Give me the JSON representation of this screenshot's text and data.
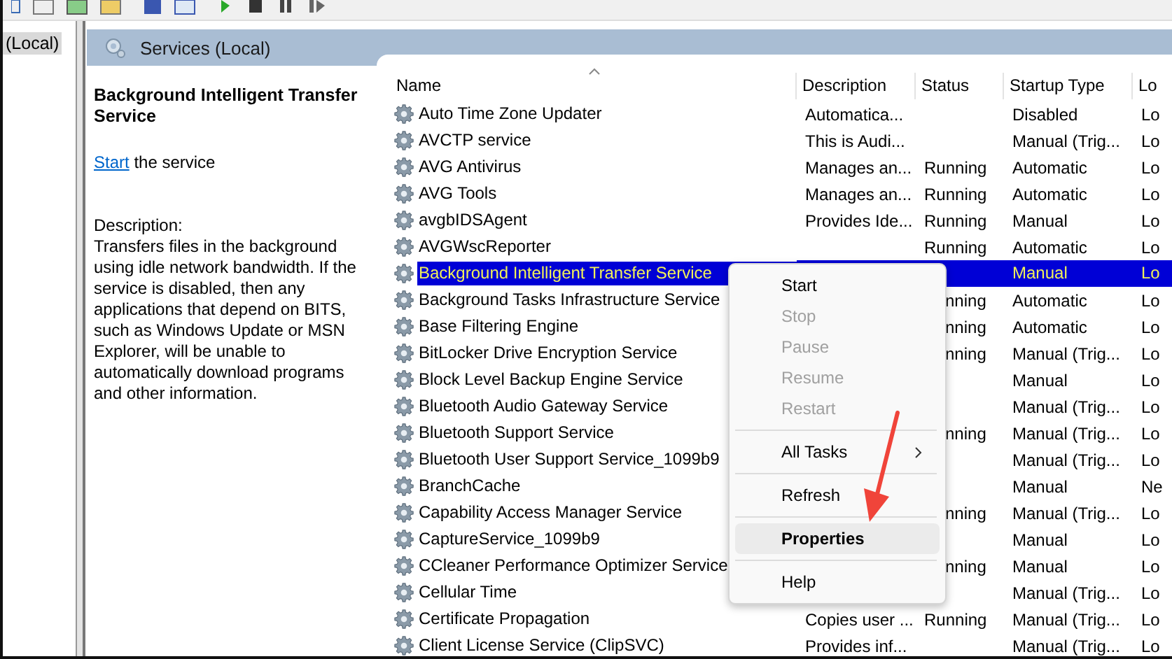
{
  "tree": {
    "items": [
      {
        "label": "(Local)",
        "selected": true
      }
    ]
  },
  "panel_header": {
    "title": "Services (Local)"
  },
  "details": {
    "title": "Background Intelligent Transfer Service",
    "action_link": "Start",
    "action_text": "the service",
    "description_label": "Description:",
    "description": "Transfers files in the background using idle network bandwidth. If the service is disabled, then any applications that depend on BITS, such as Windows Update or MSN Explorer, will be unable to automatically download programs and other information."
  },
  "table": {
    "columns": [
      "Name",
      "Description",
      "Status",
      "Startup Type",
      "Lo"
    ],
    "rows": [
      {
        "name": "Auto Time Zone Updater",
        "description": "Automatica...",
        "status": "",
        "startup": "Disabled",
        "log_on": "Lo",
        "selected": false
      },
      {
        "name": "AVCTP service",
        "description": "This is Audi...",
        "status": "",
        "startup": "Manual (Trig...",
        "log_on": "Lo",
        "selected": false
      },
      {
        "name": "AVG Antivirus",
        "description": "Manages an...",
        "status": "Running",
        "startup": "Automatic",
        "log_on": "Lo",
        "selected": false
      },
      {
        "name": "AVG Tools",
        "description": "Manages an...",
        "status": "Running",
        "startup": "Automatic",
        "log_on": "Lo",
        "selected": false
      },
      {
        "name": "avgbIDSAgent",
        "description": "Provides Ide...",
        "status": "Running",
        "startup": "Manual",
        "log_on": "Lo",
        "selected": false
      },
      {
        "name": "AVGWscReporter",
        "description": "",
        "status": "Running",
        "startup": "Automatic",
        "log_on": "Lo",
        "selected": false
      },
      {
        "name": "Background Intelligent Transfer Service",
        "description": "",
        "status": "",
        "startup": "Manual",
        "log_on": "Lo",
        "selected": true
      },
      {
        "name": "Background Tasks Infrastructure Service",
        "description": "",
        "status": "nning",
        "status_cut": true,
        "startup": "Automatic",
        "log_on": "Lo",
        "selected": false
      },
      {
        "name": "Base Filtering Engine",
        "description": "",
        "status": "nning",
        "status_cut": true,
        "startup": "Automatic",
        "log_on": "Lo",
        "selected": false
      },
      {
        "name": "BitLocker Drive Encryption Service",
        "description": "",
        "status": "nning",
        "status_cut": true,
        "startup": "Manual (Trig...",
        "log_on": "Lo",
        "selected": false
      },
      {
        "name": "Block Level Backup Engine Service",
        "description": "",
        "status": "",
        "startup": "Manual",
        "log_on": "Lo",
        "selected": false
      },
      {
        "name": "Bluetooth Audio Gateway Service",
        "description": "",
        "status": "",
        "startup": "Manual (Trig...",
        "log_on": "Lo",
        "selected": false
      },
      {
        "name": "Bluetooth Support Service",
        "description": "",
        "status": "nning",
        "status_cut": true,
        "startup": "Manual (Trig...",
        "log_on": "Lo",
        "selected": false
      },
      {
        "name": "Bluetooth User Support Service_1099b9",
        "description": "",
        "status": "",
        "startup": "Manual (Trig...",
        "log_on": "Lo",
        "selected": false
      },
      {
        "name": "BranchCache",
        "description": "",
        "status": "",
        "startup": "Manual",
        "log_on": "Ne",
        "selected": false
      },
      {
        "name": "Capability Access Manager Service",
        "description": "",
        "status": "nning",
        "status_cut": true,
        "startup": "Manual (Trig...",
        "log_on": "Lo",
        "selected": false
      },
      {
        "name": "CaptureService_1099b9",
        "description": "",
        "status": "",
        "startup": "Manual",
        "log_on": "Lo",
        "selected": false
      },
      {
        "name": "CCleaner Performance Optimizer Service",
        "description": "",
        "status": "nning",
        "status_cut": true,
        "startup": "Manual",
        "log_on": "Lo",
        "selected": false
      },
      {
        "name": "Cellular Time",
        "description": "",
        "status": "",
        "startup": "Manual (Trig...",
        "log_on": "Lo",
        "selected": false
      },
      {
        "name": "Certificate Propagation",
        "description": "Copies user ...",
        "status": "Running",
        "startup": "Manual (Trig...",
        "log_on": "Lo",
        "selected": false
      },
      {
        "name": "Client License Service (ClipSVC)",
        "description": "Provides inf...",
        "status": "",
        "startup": "Manual (Trig...",
        "log_on": "Lo",
        "selected": false
      }
    ]
  },
  "context_menu": {
    "items": [
      {
        "kind": "item",
        "label": "Start",
        "disabled": false,
        "highlighted": false
      },
      {
        "kind": "item",
        "label": "Stop",
        "disabled": true,
        "highlighted": false
      },
      {
        "kind": "item",
        "label": "Pause",
        "disabled": true,
        "highlighted": false
      },
      {
        "kind": "item",
        "label": "Resume",
        "disabled": true,
        "highlighted": false
      },
      {
        "kind": "item",
        "label": "Restart",
        "disabled": true,
        "highlighted": false
      },
      {
        "kind": "separator"
      },
      {
        "kind": "submenu",
        "label": "All Tasks",
        "disabled": false,
        "highlighted": false
      },
      {
        "kind": "separator"
      },
      {
        "kind": "item",
        "label": "Refresh",
        "disabled": false,
        "highlighted": false
      },
      {
        "kind": "separator"
      },
      {
        "kind": "default",
        "label": "Properties",
        "disabled": false,
        "highlighted": true
      },
      {
        "kind": "separator"
      },
      {
        "kind": "item",
        "label": "Help",
        "disabled": false,
        "highlighted": false
      }
    ]
  }
}
